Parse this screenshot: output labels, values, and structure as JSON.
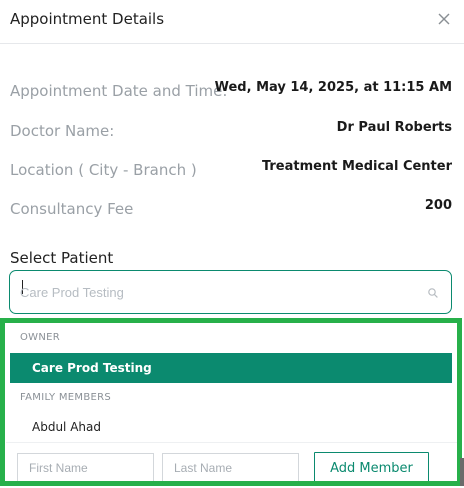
{
  "modal": {
    "title": "Appointment Details",
    "close_icon": "close-icon"
  },
  "details": [
    {
      "label": "Appointment Date and Time:",
      "value": "Wed, May 14, 2025, at 11:15 AM"
    },
    {
      "label": "Doctor Name:",
      "value": "Dr Paul Roberts"
    },
    {
      "label": "Location ( City - Branch )",
      "value": "Treatment Medical Center"
    },
    {
      "label": "Consultancy Fee",
      "value": "200"
    }
  ],
  "select_patient": {
    "label": "Select Patient",
    "placeholder": "Care Prod Testing",
    "search_icon": "search-icon"
  },
  "dropdown": {
    "owner_group_label": "OWNER",
    "owner_option": "Care Prod Testing",
    "family_group_label": "FAMILY MEMBERS",
    "family_options": [
      "Abdul Ahad"
    ]
  },
  "add_member": {
    "first_name_placeholder": "First Name",
    "last_name_placeholder": "Last Name",
    "button_label": "Add Member"
  },
  "colors": {
    "accent": "#0b8a6f",
    "highlight_outline": "#27b04a",
    "muted_text": "#9aa0a6"
  }
}
